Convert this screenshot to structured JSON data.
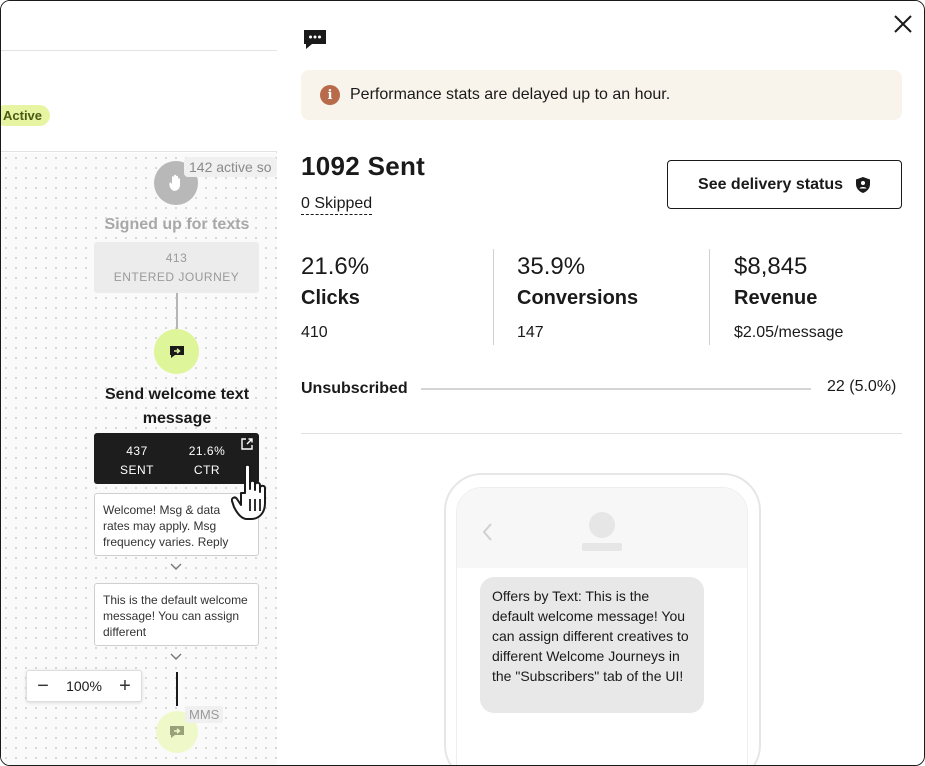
{
  "canvas": {
    "status_pill": "Active",
    "trigger_count": "142 active so",
    "trigger_title": "Signed up for texts",
    "entered": {
      "value": "413",
      "label": "ENTERED JOURNEY"
    },
    "send_title": "Send welcome text message",
    "send_stats": {
      "sent_value": "437",
      "sent_label": "SENT",
      "ctr_value": "21.6%",
      "ctr_label": "CTR"
    },
    "message_1": "Welcome! Msg & data rates may apply. Msg frequency varies. Reply",
    "message_2": "This is the default welcome message! You can assign different",
    "zoom": {
      "minus": "−",
      "value": "100%",
      "plus": "+"
    },
    "next_node_tag": "MMS"
  },
  "panel": {
    "notice": "Performance stats are delayed up to an hour.",
    "sent_title": "1092 Sent",
    "skipped": "0 Skipped",
    "delivery_button": "See delivery status",
    "metrics": [
      {
        "pct": "21.6%",
        "name": "Clicks",
        "sub": "410"
      },
      {
        "pct": "35.9%",
        "name": "Conversions",
        "sub": "147"
      },
      {
        "pct": "$8,845",
        "name": "Revenue",
        "sub": "$2.05/message"
      }
    ],
    "unsubscribed": {
      "label": "Unsubscribed",
      "value": "22 (5.0%)"
    },
    "preview_message": "Offers by Text: This is the default welcome message! You can assign different creatives to different Welcome Journeys in the \"Subscribers\" tab of the UI!"
  },
  "colors": {
    "active_pill": "#e7f5a3",
    "node_green": "#dff59a",
    "info_icon": "#b86b4b",
    "notice_bg": "#f8f4ec"
  },
  "icons": [
    "hand-wave-icon",
    "send-message-icon",
    "external-link-icon",
    "chevron-down-icon",
    "chat-bubble-icon",
    "close-icon",
    "info-icon",
    "shield-icon",
    "pointer-hand-cursor",
    "back-chevron-icon"
  ]
}
